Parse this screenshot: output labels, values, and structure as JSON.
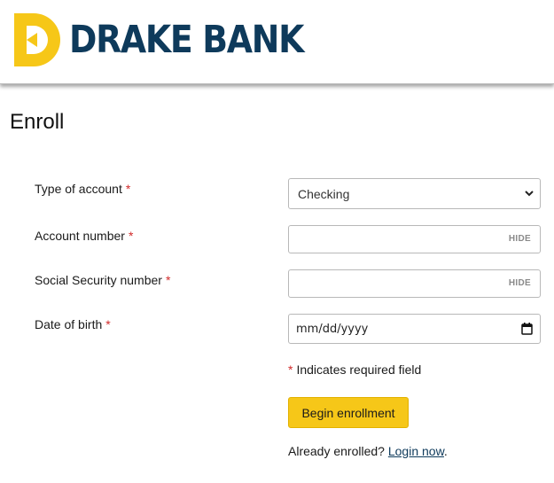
{
  "header": {
    "brand_name": "DRAKE BANK",
    "brand_color": "#0e3a5b",
    "logo_color": "#f6c718",
    "logo_icon": "drake-bank-logo"
  },
  "page": {
    "title": "Enroll"
  },
  "form": {
    "required_marker": "*",
    "account_type": {
      "label": "Type of account",
      "value": "Checking"
    },
    "account_number": {
      "label": "Account number",
      "value": "",
      "toggle_label": "HIDE"
    },
    "ssn": {
      "label": "Social Security number",
      "value": "",
      "toggle_label": "HIDE"
    },
    "dob": {
      "label": "Date of birth",
      "placeholder": "mm/dd/yyyy"
    },
    "required_note": "Indicates required field",
    "submit_label": "Begin enrollment",
    "submit_color": "#f6c718"
  },
  "footer": {
    "already_text": "Already enrolled?",
    "login_link": "Login now",
    "trailing": "."
  }
}
